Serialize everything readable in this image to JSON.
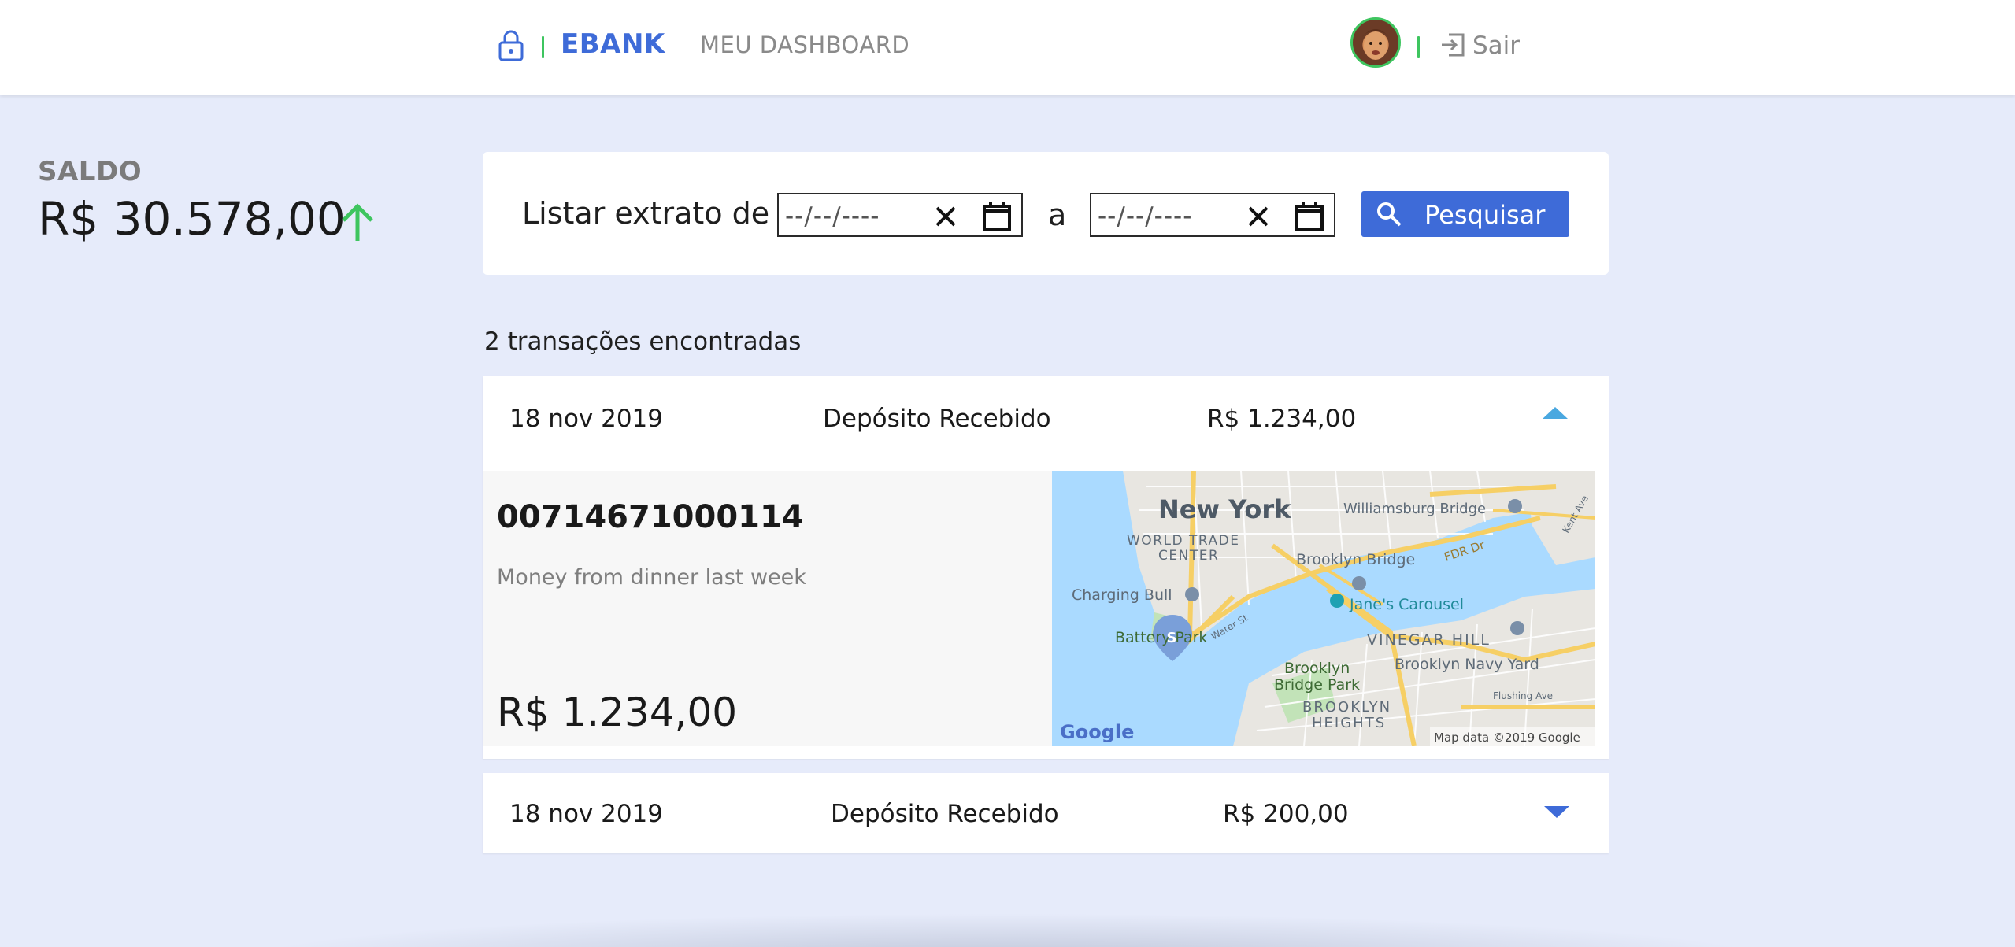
{
  "header": {
    "brand": "EBANK",
    "nav_dashboard": "MEU DASHBOARD",
    "logout_label": "Sair",
    "accent": "#3e6bd8",
    "separator_color": "#3ec55f",
    "icons": {
      "lock": "lock-icon",
      "logout": "logout-icon",
      "avatar": "user-avatar"
    }
  },
  "balance": {
    "label": "SALDO",
    "value": "R$ 30.578,00",
    "trend_icon": "arrow-up-icon",
    "trend_color": "#3ec55f"
  },
  "filter": {
    "label": "Listar extrato de",
    "from_placeholder": "--/--/----",
    "to_label": "a",
    "to_placeholder": "--/--/----",
    "search_label": "Pesquisar"
  },
  "results": {
    "count_label": "2 transações encontradas",
    "transactions": [
      {
        "date": "18 nov 2019",
        "description": "Depósito Recebido",
        "amount": "R$ 1.234,00",
        "expanded": true,
        "detail": {
          "id": "00714671000114",
          "note": "Money from dinner last week",
          "amount": "R$ 1.234,00"
        },
        "map": {
          "labels": {
            "city": "New York",
            "wtc_line1": "WORLD TRADE",
            "wtc_line2": "CENTER",
            "williamsburg": "Williamsburg Bridge",
            "brooklyn_bridge": "Brooklyn Bridge",
            "fdr": "FDR Dr",
            "charging": "Charging Bull",
            "janes": "Jane's Carousel",
            "battery": "Battery Park",
            "water_st": "Water St",
            "vinegar": "VINEGAR HILL",
            "navy_yard": "Brooklyn Navy Yard",
            "bb_park_line1": "Brooklyn",
            "bb_park_line2": "Bridge Park",
            "heights_line1": "BROOKLYN",
            "heights_line2": "HEIGHTS",
            "flushing": "Flushing Ave",
            "kent": "Kent Ave",
            "google": "Google",
            "attribution": "Map data ©2019 Google",
            "marker": "S"
          }
        }
      },
      {
        "date": "18 nov 2019",
        "description": "Depósito Recebido",
        "amount": "R$ 200,00",
        "expanded": false
      }
    ]
  }
}
